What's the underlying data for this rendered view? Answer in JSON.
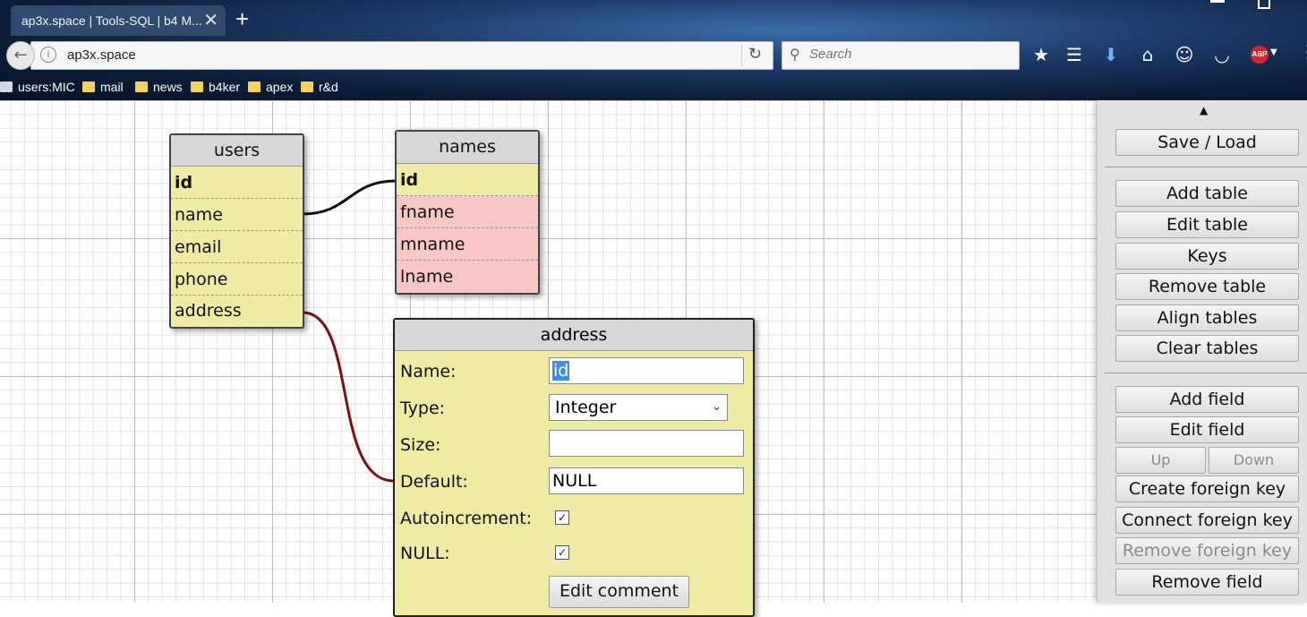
{
  "browser": {
    "tab_title": "ap3x.space | Tools-SQL | b4 M...",
    "url": "ap3x.space",
    "search_placeholder": "Search",
    "bookmarks": [
      {
        "label": "users:MIC"
      },
      {
        "label": "mail"
      },
      {
        "label": "news"
      },
      {
        "label": "b4ker"
      },
      {
        "label": "apex"
      },
      {
        "label": "r&d"
      }
    ],
    "toolbar_icons": [
      "star-icon",
      "reading-list-icon",
      "download-icon",
      "home-icon",
      "smiley-icon",
      "pocket-icon",
      "adblock-icon",
      "menu-icon"
    ],
    "adblock_label": "ABP"
  },
  "tables": {
    "users": {
      "name": "users",
      "fields": [
        "id",
        "name",
        "email",
        "phone",
        "address"
      ]
    },
    "names": {
      "name": "names",
      "fields": [
        "id",
        "fname",
        "mname",
        "lname"
      ]
    }
  },
  "editor": {
    "table_name": "address",
    "labels": {
      "name": "Name:",
      "type": "Type:",
      "size": "Size:",
      "default": "Default:",
      "autoincrement": "Autoincrement:",
      "null": "NULL:"
    },
    "values": {
      "name": "id",
      "type": "Integer",
      "size": "",
      "default": "NULL",
      "autoincrement": true,
      "null": true
    },
    "edit_comment": "Edit comment"
  },
  "panel": {
    "save_load": "Save / Load",
    "add_table": "Add table",
    "edit_table": "Edit table",
    "keys": "Keys",
    "remove_table": "Remove table",
    "align_tables": "Align tables",
    "clear_tables": "Clear tables",
    "add_field": "Add field",
    "edit_field": "Edit field",
    "up": "Up",
    "down": "Down",
    "create_foreign_key": "Create foreign key",
    "connect_foreign_key": "Connect foreign key",
    "remove_foreign_key": "Remove foreign key",
    "remove_field": "Remove field"
  },
  "colors": {
    "table_bg": "#efeba4",
    "table_header": "#d7d7d7",
    "foreign_row": "#f9c6c6",
    "relation_black": "#111111",
    "relation_red": "#7a1010",
    "selection": "#3b8de8"
  }
}
